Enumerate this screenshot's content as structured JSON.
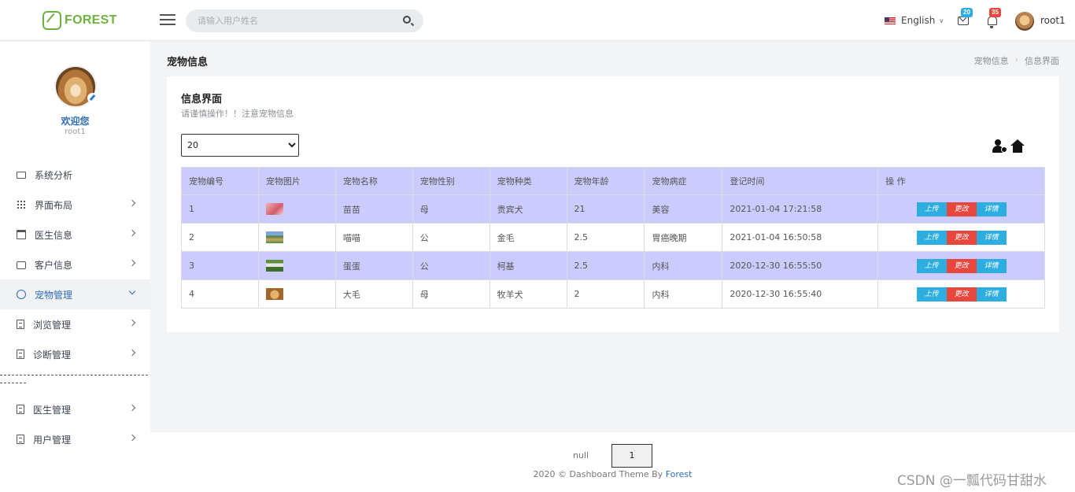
{
  "brand": {
    "logo_text": "FOREST"
  },
  "search": {
    "placeholder": "请输入用户姓名"
  },
  "topbar": {
    "language": "English",
    "mail_count": "20",
    "notif_count": "35",
    "username": "root1"
  },
  "sidebar": {
    "welcome": "欢迎您",
    "name": "root1",
    "items": [
      {
        "label": "系统分析",
        "icon": "monitor-icon",
        "expandable": false
      },
      {
        "label": "界面布局",
        "icon": "grid-icon",
        "expandable": true
      },
      {
        "label": "医生信息",
        "icon": "calendar-icon",
        "expandable": true
      },
      {
        "label": "客户信息",
        "icon": "briefcase-icon",
        "expandable": true
      },
      {
        "label": "宠物管理",
        "icon": "clock-icon",
        "expandable": true,
        "active": true
      },
      {
        "label": "浏览管理",
        "icon": "document-icon",
        "expandable": true
      },
      {
        "label": "诊断管理",
        "icon": "document-icon",
        "expandable": true
      }
    ],
    "items2": [
      {
        "label": "医生管理",
        "icon": "document-icon",
        "expandable": true
      },
      {
        "label": "用户管理",
        "icon": "document-icon",
        "expandable": true
      }
    ]
  },
  "header": {
    "title": "宠物信息",
    "breadcrumb": [
      "宠物信息",
      "信息界面"
    ]
  },
  "card": {
    "title": "信息界面",
    "subtitle": "请谨慎操作！！注意宠物信息",
    "page_size": "20"
  },
  "table": {
    "columns": [
      "宠物编号",
      "宠物图片",
      "宠物名称",
      "宠物性别",
      "宠物种类",
      "宠物年龄",
      "宠物病症",
      "登记时间",
      "操 作"
    ],
    "rows": [
      {
        "id": "1",
        "name": "苗苗",
        "sex": "母",
        "kind": "贵宾犬",
        "age": "21",
        "illness": "美容",
        "time": "2021-01-04 17:21:58",
        "highlight": true,
        "thumb": "pink"
      },
      {
        "id": "2",
        "name": "喵喵",
        "sex": "公",
        "kind": "金毛",
        "age": "2.5",
        "illness": "胃癌晚期",
        "time": "2021-01-04 16:50:58",
        "highlight": false,
        "thumb": "green"
      },
      {
        "id": "3",
        "name": "蛋蛋",
        "sex": "公",
        "kind": "柯基",
        "age": "2.5",
        "illness": "内科",
        "time": "2020-12-30 16:55:50",
        "highlight": true,
        "thumb": "grass"
      },
      {
        "id": "4",
        "name": "大毛",
        "sex": "母",
        "kind": "牧羊犬",
        "age": "2",
        "illness": "内科",
        "time": "2020-12-30 16:55:40",
        "highlight": false,
        "thumb": "tan"
      }
    ],
    "actions": [
      "上传",
      "更改",
      "详情"
    ]
  },
  "pagination": {
    "info": "null",
    "current": "1"
  },
  "footer": {
    "text": "2020 © Dashboard Theme By ",
    "link": "Forest"
  },
  "watermark": "CSDN @一瓢代码甘甜水",
  "colors": {
    "accent": "#2f6db5",
    "row_highlight": "#cccbfd",
    "btn_blue": "#2eaee0",
    "btn_red": "#e9473e",
    "logo": "#6cb33f"
  }
}
